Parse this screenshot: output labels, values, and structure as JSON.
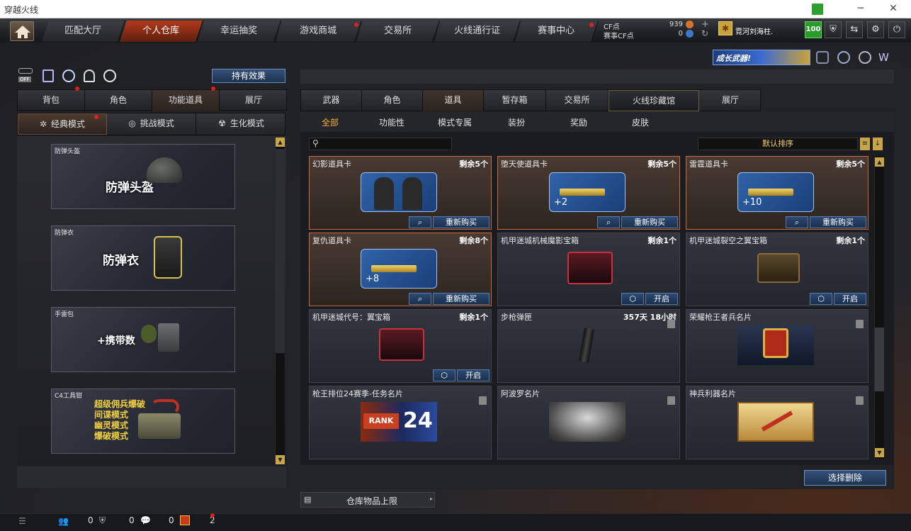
{
  "window": {
    "title": "穿越火线"
  },
  "top_nav": {
    "tabs": [
      "匹配大厅",
      "个人仓库",
      "幸运抽奖",
      "游戏商城",
      "交易所",
      "火线通行证",
      "赛事中心"
    ],
    "cf_label": "CF点",
    "cf_value": "939",
    "match_cf_label": "赛事CF点",
    "match_cf_value": "0",
    "username": "霓河刘海柱.",
    "level": "100"
  },
  "banner": {
    "text": "成长武器!"
  },
  "left": {
    "effect_button": "持有效果",
    "toggle_off": "OFF",
    "tabs": [
      "背包",
      "角色",
      "功能道具",
      "展厅"
    ],
    "modes": [
      "经典模式",
      "挑战模式",
      "生化模式"
    ],
    "cards": [
      {
        "label": "防弹头盔",
        "big": "防弹头盔"
      },
      {
        "label": "防弹衣",
        "big": "防弹衣"
      },
      {
        "label": "手雷包",
        "big": "+携带数"
      },
      {
        "label": "C4工具钳",
        "lines": [
          "超级佣兵爆破",
          "间谍模式",
          "幽灵模式",
          "爆破模式"
        ]
      }
    ]
  },
  "right": {
    "tabs": [
      "武器",
      "角色",
      "道具",
      "暂存箱",
      "交易所",
      "火线珍藏馆",
      "展厅"
    ],
    "subtabs": [
      "全部",
      "功能性",
      "模式专属",
      "装扮",
      "奖励",
      "皮肤"
    ],
    "search_placeholder": "",
    "sort": "默认排序",
    "items": [
      {
        "name": "幻影道具卡",
        "remain": "剩余5个",
        "buttons": [
          "重新购买"
        ],
        "style": "gold",
        "art": "soldiers"
      },
      {
        "name": "堕天使道具卡",
        "remain": "剩余5个",
        "buttons": [
          "重新购买"
        ],
        "style": "gold",
        "art": "gun",
        "bonus": "+2"
      },
      {
        "name": "雷霆道具卡",
        "remain": "剩余5个",
        "buttons": [
          "重新购买"
        ],
        "style": "gold",
        "art": "gun",
        "bonus": "+10"
      },
      {
        "name": "复仇道具卡",
        "remain": "剩余8个",
        "buttons": [
          "重新购买"
        ],
        "style": "gold",
        "art": "gun",
        "bonus": "+8"
      },
      {
        "name": "机甲迷城机械魔影宝箱",
        "remain": "剩余1个",
        "buttons": [
          "开启"
        ],
        "style": "blue",
        "art": "redbox"
      },
      {
        "name": "机甲迷城裂空之翼宝箱",
        "remain": "剩余1个",
        "buttons": [
          "开启"
        ],
        "style": "blue",
        "art": "chest"
      },
      {
        "name": "机甲迷城代号：翼宝箱",
        "remain": "剩余1个",
        "buttons": [
          "开启"
        ],
        "style": "blue",
        "art": "redbox"
      },
      {
        "name": "步枪弹匣",
        "remain": "357天 18小时",
        "buttons": [],
        "style": "blue",
        "art": "mag",
        "trash": true
      },
      {
        "name": "荣耀枪王者兵名片",
        "remain": "",
        "buttons": [],
        "style": "blue",
        "art": "emblem",
        "trash": true
      },
      {
        "name": "枪王排位24赛季-任务名片",
        "remain": "",
        "buttons": [],
        "style": "blue",
        "art": "rank",
        "rank_text": "RANK",
        "rank_num": "24",
        "trash": true
      },
      {
        "name": "阿波罗名片",
        "remain": "",
        "buttons": [],
        "style": "blue",
        "art": "statue",
        "trash": true
      },
      {
        "name": "神兵利器名片",
        "remain": "",
        "buttons": [],
        "style": "blue",
        "art": "scroll",
        "trash": true
      }
    ],
    "select_delete": "选择删除",
    "storage_limit": "仓库物品上限"
  },
  "status_bar": {
    "friends": "0",
    "shield": "0",
    "chat": "0",
    "gift": "2"
  }
}
